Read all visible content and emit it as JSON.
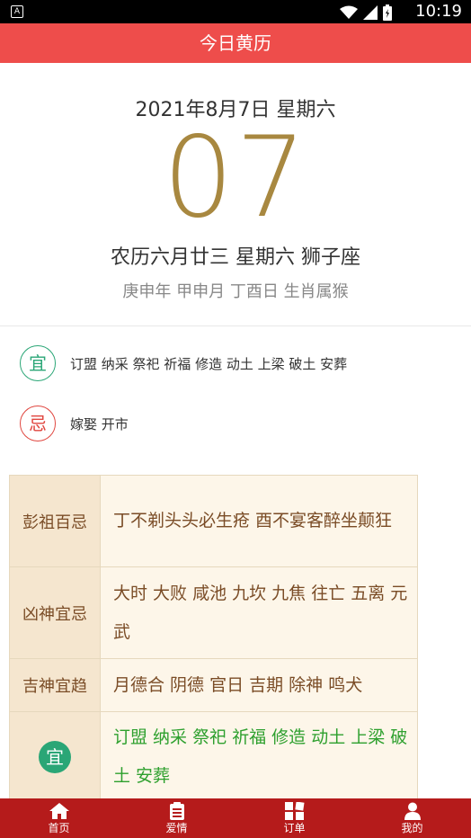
{
  "status_bar": {
    "time": "10:19",
    "app_icon_letter": "A"
  },
  "header": {
    "title": "今日黄历"
  },
  "date": {
    "full": "2021年8月7日 星期六",
    "day_big": "07",
    "lunar": "农历六月廿三 星期六 狮子座",
    "ganzhi": "庚申年 甲申月 丁酉日 生肖属猴"
  },
  "yiji": {
    "yi_label": "宜",
    "yi_text": "订盟 纳采 祭祀 祈福 修造 动土 上梁 破土 安葬",
    "ji_label": "忌",
    "ji_text": "嫁娶 开市"
  },
  "almanac": {
    "rows": [
      {
        "key": "彭祖百忌",
        "value": "丁不剃头头必生疮 酉不宴客醉坐颠狂"
      },
      {
        "key": "凶神宜忌",
        "value": "大时 大败 咸池 九坎 九焦 往亡 五离 元武"
      },
      {
        "key": "吉神宜趋",
        "value": "月德合 阴德 官日 吉期 除神 鸣犬"
      }
    ],
    "yi_row": {
      "badge": "宜",
      "value": "订盟 纳采 祭祀 祈福 修造 动土 上梁 破土 安葬"
    }
  },
  "nav": {
    "items": [
      {
        "label": "首页",
        "icon": "home-icon"
      },
      {
        "label": "爱情",
        "icon": "document-icon"
      },
      {
        "label": "订单",
        "icon": "grid-icon"
      },
      {
        "label": "我的",
        "icon": "person-icon"
      }
    ]
  },
  "colors": {
    "header_bg": "#ee4d4b",
    "big_day": "#a88840",
    "yi_green": "#2aa676",
    "ji_red": "#e0463f",
    "nav_bg": "#b51b1b"
  }
}
